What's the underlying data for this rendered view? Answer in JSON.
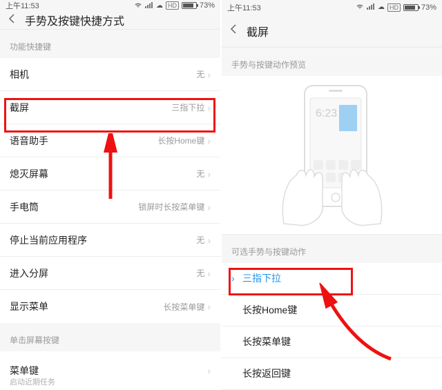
{
  "status": {
    "time": "上午11:53",
    "hd": "HD",
    "battery": "73%"
  },
  "left": {
    "title": "手势及按键快捷方式",
    "section1": "功能快捷键",
    "rows": [
      {
        "label": "相机",
        "value": "无"
      },
      {
        "label": "截屏",
        "value": "三指下拉"
      },
      {
        "label": "语音助手",
        "value": "长按Home键"
      },
      {
        "label": "熄灭屏幕",
        "value": "无"
      },
      {
        "label": "手电筒",
        "value": "锁屏时长按菜单键"
      },
      {
        "label": "停止当前应用程序",
        "value": "无"
      },
      {
        "label": "进入分屏",
        "value": "无"
      },
      {
        "label": "显示菜单",
        "value": "长按菜单键"
      }
    ],
    "section2": "单击屏幕按键",
    "row2": {
      "label": "菜单键",
      "sub": "启动近期任务"
    }
  },
  "right": {
    "title": "截屏",
    "previewHeader": "手势与按键动作预览",
    "previewTime": "6:23",
    "optionsHeader": "可选手势与按键动作",
    "options": [
      "三指下拉",
      "长按Home键",
      "长按菜单键",
      "长按返回键"
    ]
  }
}
